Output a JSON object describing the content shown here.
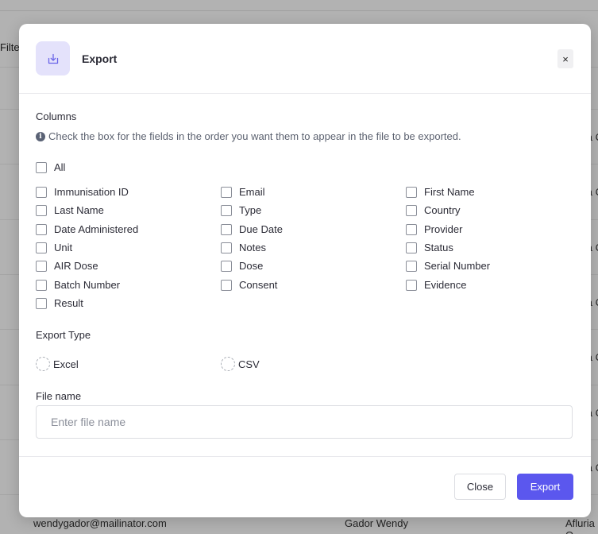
{
  "background": {
    "filter_label_fragment": "Filte",
    "bottom_row": {
      "email": "wendygador@mailinator.com",
      "name": "Gador Wendy",
      "provider_fragment": "Afluria Q"
    },
    "right_fragments": [
      "a C",
      "a C",
      "a C",
      "a C",
      "a C",
      "a C",
      "a C"
    ]
  },
  "modal": {
    "title": "Export",
    "icon": "download-tray-icon",
    "close_label": "×",
    "columns_label": "Columns",
    "info_text": "Check the box for the fields in the order you want them to appear in the file to be exported.",
    "all_label": "All",
    "columns": [
      [
        "Immunisation ID",
        "Email",
        "First Name"
      ],
      [
        "Last Name",
        "Type",
        "Country"
      ],
      [
        "Date Administered",
        "Due Date",
        "Provider"
      ],
      [
        "Unit",
        "Notes",
        "Status"
      ],
      [
        "AIR Dose",
        "Dose",
        "Serial Number"
      ],
      [
        "Batch Number",
        "Consent",
        "Evidence"
      ],
      [
        "Result"
      ]
    ],
    "export_type_label": "Export Type",
    "export_types": [
      "Excel",
      "CSV"
    ],
    "file_name_label": "File name",
    "file_name_placeholder": "Enter file name",
    "file_name_value": "",
    "close_button": "Close",
    "export_button": "Export",
    "accent_color": "#5b57ee",
    "icon_bg_color": "#e4e2fb"
  }
}
